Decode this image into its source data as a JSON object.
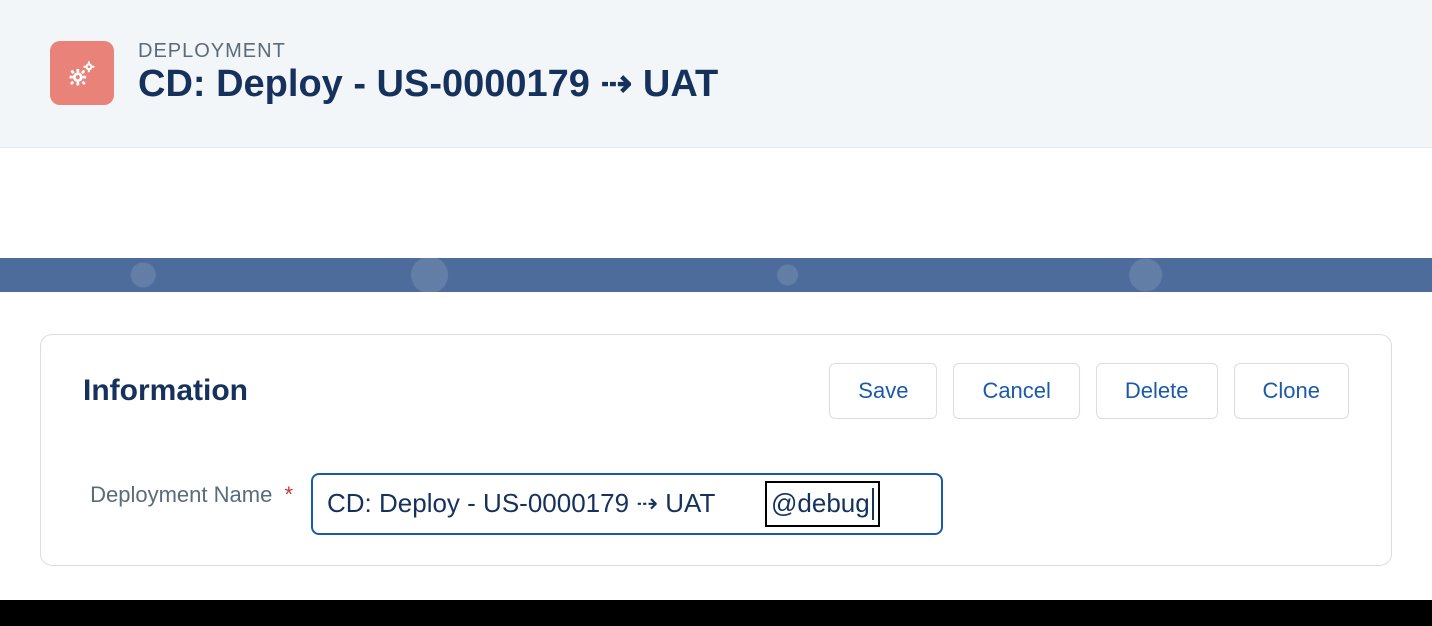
{
  "header": {
    "object_label": "DEPLOYMENT",
    "title": "CD: Deploy - US-0000179 ⇢ UAT"
  },
  "section": {
    "title": "Information"
  },
  "actions": {
    "save": "Save",
    "cancel": "Cancel",
    "delete": "Delete",
    "clone": "Clone"
  },
  "form": {
    "deployment_name": {
      "label": "Deployment Name",
      "required_marker": "*",
      "value": "CD: Deploy - US-0000179 ⇢ UAT @debug",
      "base_value": "CD: Deploy - US-0000179 ⇢ UAT ",
      "ime_text": "@debug"
    }
  }
}
